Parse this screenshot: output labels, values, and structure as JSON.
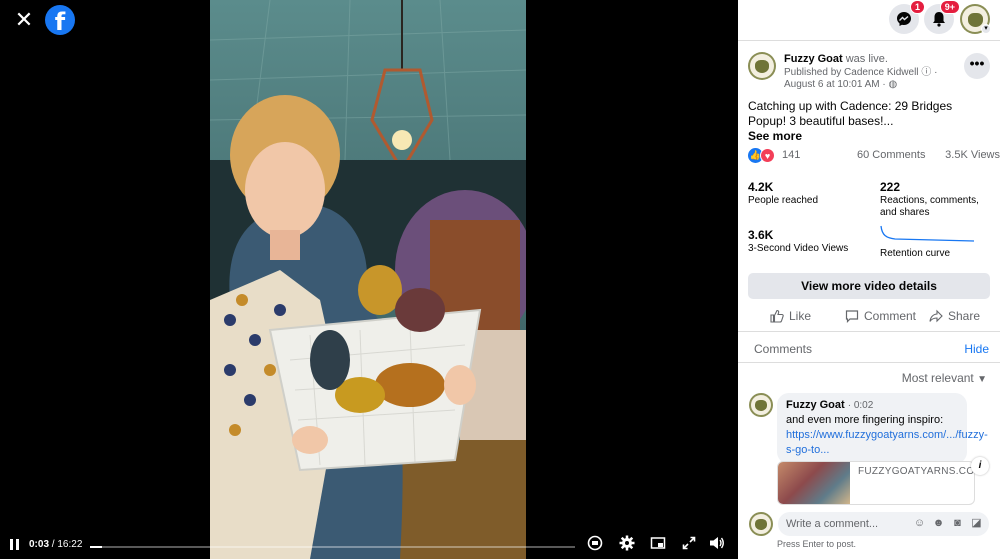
{
  "colors": {
    "brand": "#1877f2",
    "badge": "#e41e3f",
    "like": "#1877f2",
    "love": "#f33e58",
    "link": "#216fdb"
  },
  "viewer": {
    "close_icon": "close-icon",
    "logo_letter": "f",
    "player": {
      "current_time": "0:03",
      "separator": " / ",
      "duration": "16:22",
      "progress": 0.003
    }
  },
  "topbar": {
    "messenger_badge": "1",
    "notifications_badge": "9+"
  },
  "post": {
    "page_name": "Fuzzy Goat",
    "action": "was live.",
    "published_by": "Published by Cadence Kidwell",
    "date": "August 6 at 10:01 AM",
    "more_label": "•••",
    "text": "Catching up with Cadence: 29 Bridges Popup! 3 beautiful bases!...",
    "see_more": "See more",
    "reaction_count": "141",
    "comments_count": "60 Comments",
    "views_count": "3.5K Views"
  },
  "stats": {
    "reach_value": "4.2K",
    "reach_label": "People reached",
    "engagement_value": "222",
    "engagement_label": "Reactions, comments, and shares",
    "views3s_value": "3.6K",
    "views3s_label": "3-Second Video Views",
    "retention_label": "Retention curve"
  },
  "buttons": {
    "view_details": "View more video details",
    "like": "Like",
    "comment": "Comment",
    "share": "Share"
  },
  "comments": {
    "heading": "Comments",
    "hide": "Hide",
    "sort": "Most relevant",
    "items": [
      {
        "author": "Fuzzy Goat",
        "timestamp": "0:02",
        "text": "and even more fingering inspiro:",
        "link": "https://www.fuzzygoatyarns.com/.../fuzzy-s-go-to...",
        "card_domain": "FUZZYGOATYARNS.COM"
      }
    ],
    "composer_placeholder": "Write a comment...",
    "composer_hint": "Press Enter to post."
  }
}
